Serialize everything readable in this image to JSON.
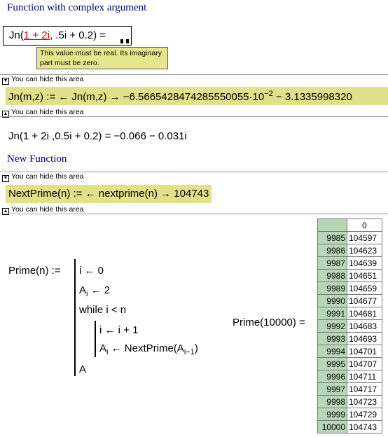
{
  "section1_title": "Function with complex argument",
  "jn_input": {
    "prefix": "Jn(",
    "error_arg": "1 + 2i",
    "rest": ", .5i + 0.2) ="
  },
  "tooltip": "This value must be real. Its imaginary part must be zero.",
  "region_label": "You can hide this area",
  "jn_def": "Jn(m,z) :=   ← Jn(m,z) → −6.5665428474285550055·10",
  "jn_def_exp": "−2",
  "jn_def_tail": " − 3.1335998320",
  "jn_result": "Jn(1 + 2i ,0.5i + 0.2) = −0.066 − 0.031i",
  "section2_title": "New Function",
  "nextprime_def": "NextPrime(n) :=   ← nextprime(n) → 104743",
  "prime_program": {
    "lhs": "Prime(n) :=",
    "line1": "i ← 0",
    "line2_a": "A",
    "line2_sub": "i",
    "line2_b": " ← 2",
    "line3": "while   i < n",
    "line4": "i ← i + 1",
    "line5_a": "A",
    "line5_sub": "i",
    "line5_b": " ← NextPrime(A",
    "line5_sub2": "i−1",
    "line5_c": ")",
    "line6": "A"
  },
  "prime_eval_lhs": "Prime(10000) =",
  "table": {
    "col_header": "0",
    "rows": [
      [
        "9985",
        "104597"
      ],
      [
        "9986",
        "104623"
      ],
      [
        "9987",
        "104639"
      ],
      [
        "9988",
        "104651"
      ],
      [
        "9989",
        "104659"
      ],
      [
        "9990",
        "104677"
      ],
      [
        "9991",
        "104681"
      ],
      [
        "9992",
        "104683"
      ],
      [
        "9993",
        "104693"
      ],
      [
        "9994",
        "104701"
      ],
      [
        "9995",
        "104707"
      ],
      [
        "9996",
        "104711"
      ],
      [
        "9997",
        "104717"
      ],
      [
        "9998",
        "104723"
      ],
      [
        "9999",
        "104729"
      ],
      [
        "10000",
        "104743"
      ]
    ]
  }
}
